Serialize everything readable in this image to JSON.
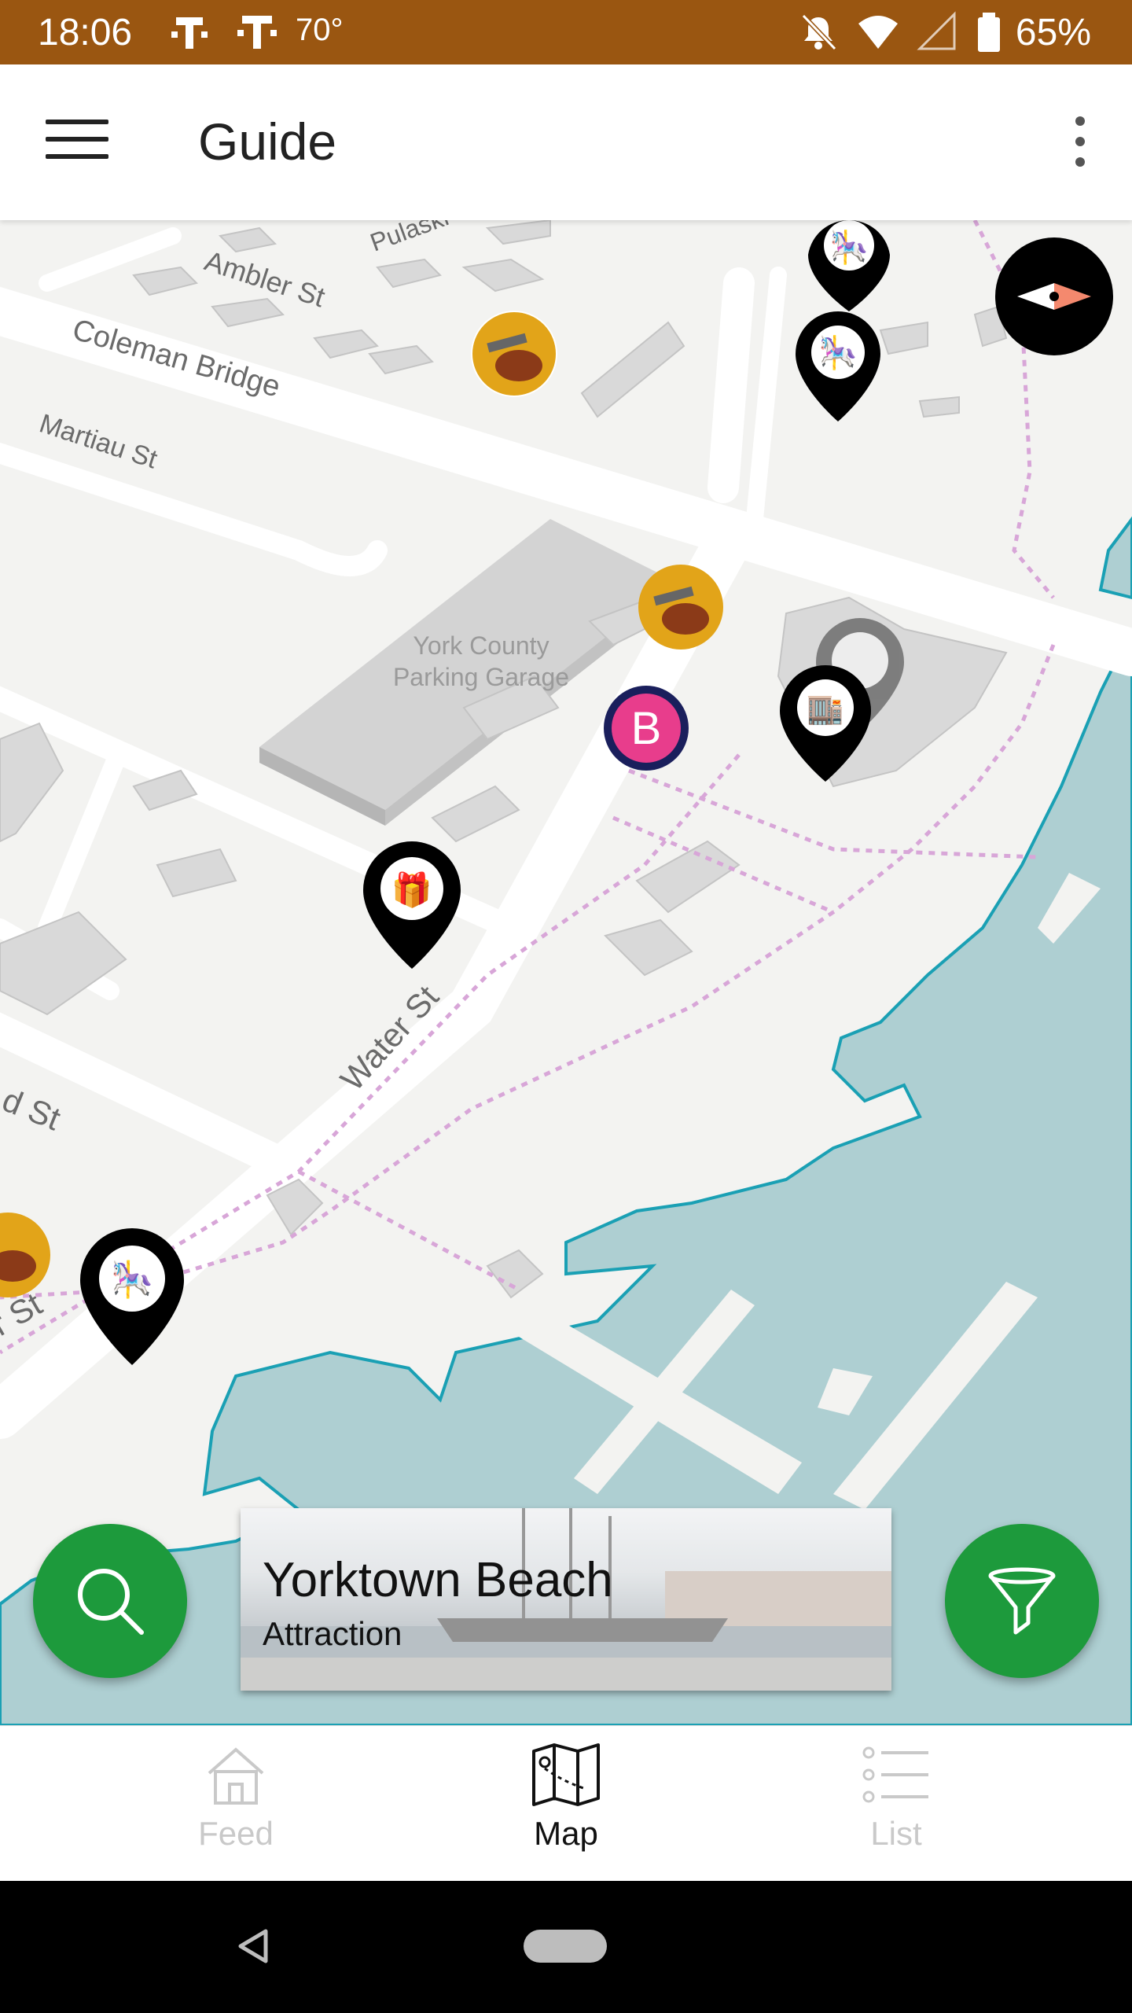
{
  "status_bar": {
    "time": "18:06",
    "temperature": "70°",
    "battery_percent": "65%"
  },
  "app_bar": {
    "title": "Guide"
  },
  "map": {
    "street_labels": [
      "Ambler St",
      "Coleman Bridge",
      "Martiau St",
      "Water St",
      "d St",
      "r St",
      "Pulaski"
    ],
    "place_labels": [
      "York County",
      "Parking Garage"
    ],
    "pins": [
      "carousel-pin",
      "carousel-pin",
      "shop-pin",
      "food-pin",
      "food-pin",
      "carousel-pin"
    ],
    "photo_markers": [
      "cannon-photo-marker",
      "cannon-photo-marker",
      "cannon-photo-marker",
      "b-logo-marker"
    ]
  },
  "selected_place": {
    "name": "Yorktown Beach",
    "category": "Attraction"
  },
  "bottom_nav": {
    "items": [
      {
        "label": "Feed",
        "icon": "home-icon",
        "active": false
      },
      {
        "label": "Map",
        "icon": "map-icon",
        "active": true
      },
      {
        "label": "List",
        "icon": "list-icon",
        "active": false
      }
    ]
  },
  "colors": {
    "status_bar": "#9a5611",
    "fab_green": "#1d9a3c",
    "water": "#aecfd2",
    "water_edge": "#1aa0b4",
    "trail": "#d8a6d8"
  }
}
